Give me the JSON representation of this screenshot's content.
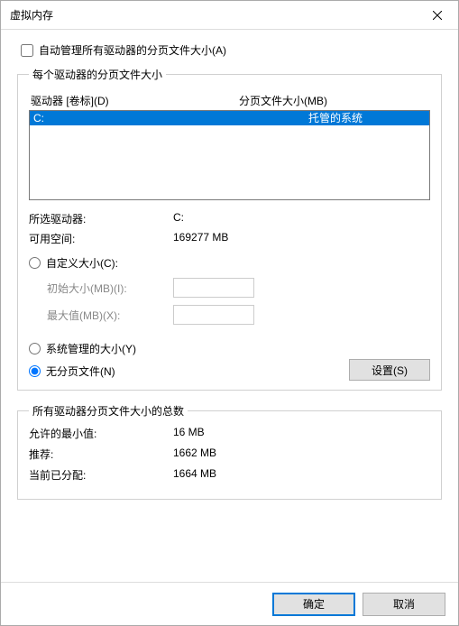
{
  "title": "虚拟内存",
  "autoManage": "自动管理所有驱动器的分页文件大小(A)",
  "group1": {
    "legend": "每个驱动器的分页文件大小",
    "headerDrive": "驱动器 [卷标](D)",
    "headerSize": "分页文件大小(MB)",
    "drives": [
      {
        "name": "C:",
        "size": "托管的系统"
      }
    ],
    "selectedDriveLabel": "所选驱动器:",
    "selectedDriveValue": "C:",
    "freeSpaceLabel": "可用空间:",
    "freeSpaceValue": "169277 MB",
    "radioCustom": "自定义大小(C):",
    "initialSizeLabel": "初始大小(MB)(I):",
    "maxSizeLabel": "最大值(MB)(X):",
    "radioSystem": "系统管理的大小(Y)",
    "radioNone": "无分页文件(N)",
    "setButton": "设置(S)"
  },
  "group2": {
    "legend": "所有驱动器分页文件大小的总数",
    "minLabel": "允许的最小值:",
    "minValue": "16 MB",
    "recLabel": "推荐:",
    "recValue": "1662 MB",
    "curLabel": "当前已分配:",
    "curValue": "1664 MB"
  },
  "ok": "确定",
  "cancel": "取消"
}
